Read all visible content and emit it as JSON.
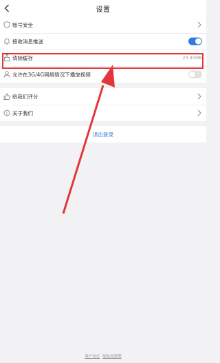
{
  "header": {
    "title": "设置"
  },
  "settings": {
    "account_security": "账号安全",
    "push": "接收消息推送",
    "clear_cache": "清除缓存",
    "cache_size": "23.40MB",
    "video_3g": "允许在3G/4G网络情况下播放视频",
    "rate": "给我们评分",
    "about": "关于我们"
  },
  "toggles": {
    "push_enabled": true,
    "video_3g_enabled": false
  },
  "logout": {
    "label": "退出登录"
  },
  "footer": {
    "user_agreement": "用户协议",
    "privacy_policy": "隐私权政策"
  },
  "colors": {
    "accent": "#2f7be2",
    "annotation": "#e2373a",
    "logout_text": "#3b78d8",
    "background": "#f2f2f4"
  },
  "icons": {
    "back": "chevron-left-icon",
    "shield": "shield-icon",
    "bell": "bell-icon",
    "broom": "broom-icon",
    "person": "person-icon",
    "thumb": "thumbs-up-icon",
    "info": "info-icon"
  }
}
